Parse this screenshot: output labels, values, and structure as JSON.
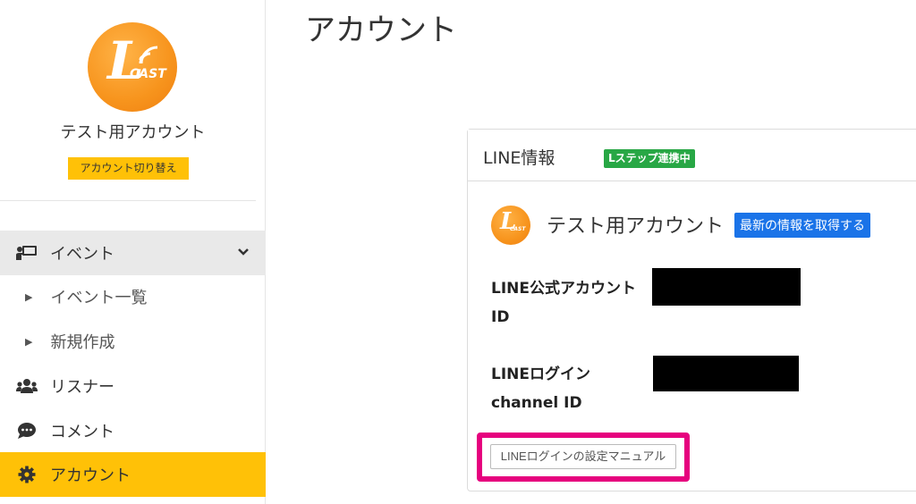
{
  "sidebar": {
    "account_name": "テスト用アカウント",
    "switch_label": "アカウント切り替え",
    "logo_text": "CAST",
    "nav": {
      "event": "イベント",
      "event_list": "イベント一覧",
      "new": "新規作成",
      "listener": "リスナー",
      "comment": "コメント",
      "account": "アカウント"
    }
  },
  "main": {
    "title": "アカウント",
    "card": {
      "title": "LINE情報",
      "badge": "Lステップ連携中",
      "account_name": "テスト用アカウント",
      "refresh_button": "最新の情報を取得する",
      "official_id_label_1": "LINE公式アカウント",
      "official_id_label_2": "ID",
      "login_label_1": "LINEログイン",
      "login_label_2": "channel ID",
      "manual_button": "LINEログインの設定マニュアル"
    }
  },
  "colors": {
    "accent_yellow": "#ffc107",
    "badge_green": "#28a745",
    "button_blue": "#1a73e8",
    "highlight_pink": "#e6007e",
    "logo_orange": "#f7941d"
  }
}
